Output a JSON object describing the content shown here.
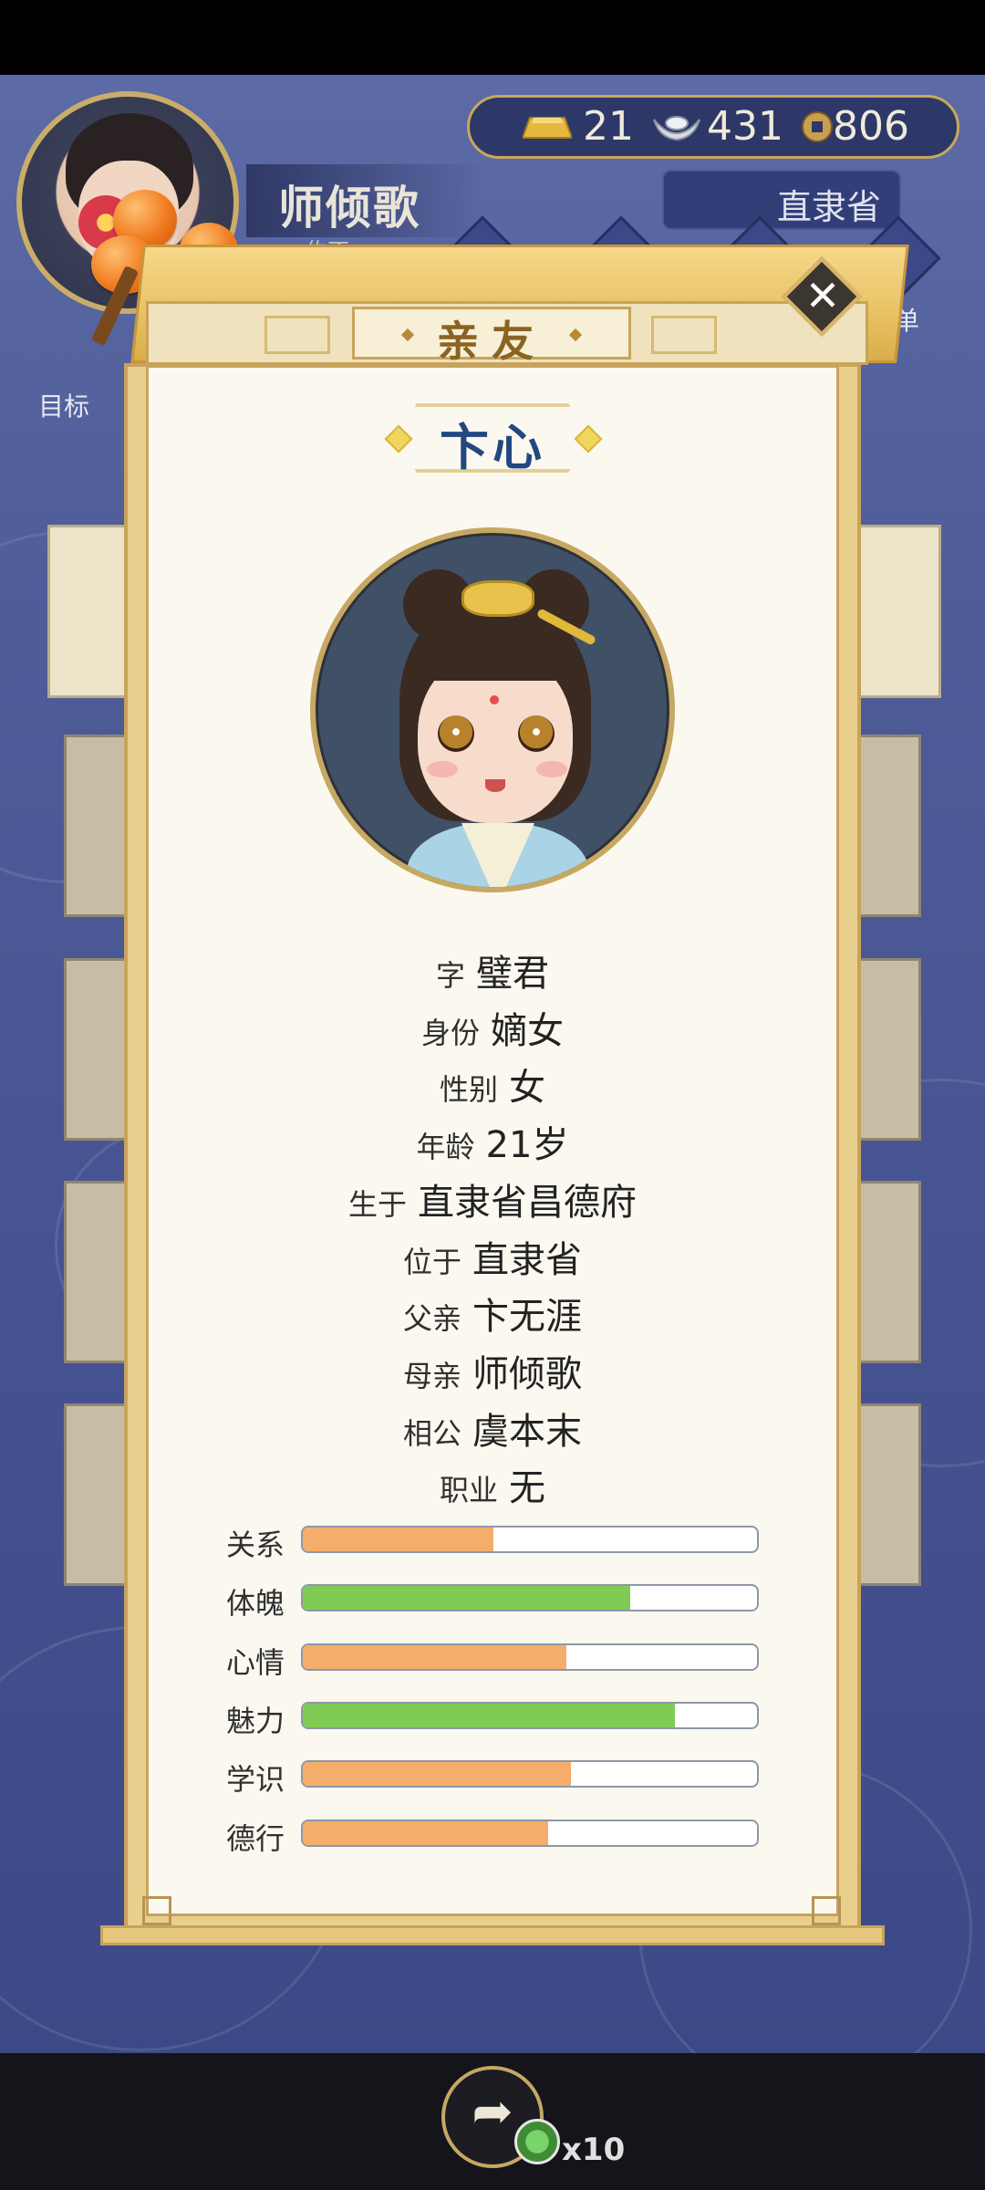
{
  "header": {
    "player_name": "师倾歌",
    "player_sub": "佐丁",
    "currency": [
      {
        "icon": "gold-bar-icon",
        "value": "21"
      },
      {
        "icon": "silver-ingot-icon",
        "value": "431"
      },
      {
        "icon": "copper-coin-icon",
        "value": "806"
      }
    ],
    "location": "直隶省",
    "menu_label": "菜单",
    "goal_label": "目标"
  },
  "dialog": {
    "title": "亲友",
    "close_icon": "close-icon",
    "character_name": "卞心",
    "info": [
      {
        "label": "字",
        "value": "璧君"
      },
      {
        "label": "身份",
        "value": "嫡女"
      },
      {
        "label": "性别",
        "value": "女"
      },
      {
        "label": "年龄",
        "value": "21岁"
      },
      {
        "label": "生于",
        "value": "直隶省昌德府"
      },
      {
        "label": "位于",
        "value": "直隶省"
      },
      {
        "label": "父亲",
        "value": "卞无涯"
      },
      {
        "label": "母亲",
        "value": "师倾歌"
      },
      {
        "label": "相公",
        "value": "虞本末"
      },
      {
        "label": "职业",
        "value": "无"
      }
    ],
    "stats": [
      {
        "label": "关系",
        "level": 0.42,
        "color": "#f4ad6a"
      },
      {
        "label": "体魄",
        "level": 0.72,
        "color": "#7fcb54"
      },
      {
        "label": "心情",
        "level": 0.58,
        "color": "#f4ad6a"
      },
      {
        "label": "魅力",
        "level": 0.82,
        "color": "#7fcb54"
      },
      {
        "label": "学识",
        "level": 0.59,
        "color": "#f4ad6a"
      },
      {
        "label": "德行",
        "level": 0.54,
        "color": "#f4ad6a"
      }
    ]
  },
  "bottom": {
    "share_icon": "share-icon",
    "reward_icon": "jade-coin-icon",
    "reward_count": "x10"
  }
}
